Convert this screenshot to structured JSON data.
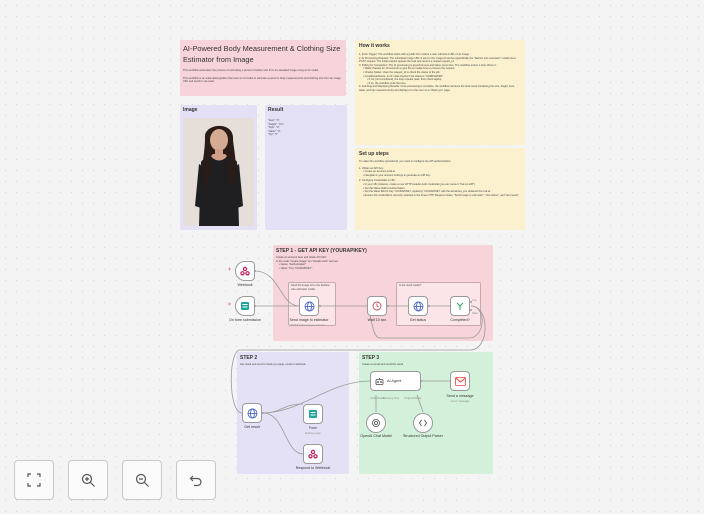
{
  "intro": {
    "title": "AI-Powered Body Measurement & Clothing Size Estimator from Image",
    "para1": "This workflow automates the process of estimating a person's fashion size from an uploaded image using an AI model.",
    "para2": "This workflow is an automated pipeline that uses an AI model to estimate a person's body measurements and clothing size from an image URL and sends it via email."
  },
  "image_panel": {
    "title": "Image"
  },
  "result_panel": {
    "title": "Result",
    "lines": [
      "\"bust\": \"0\",",
      "\"height\": \"0.0\",",
      "\"hips\": \"0\",",
      "\"waist\": \"0\",",
      "\"hip\": \"0\""
    ]
  },
  "how": {
    "title": "How it works",
    "items": [
      "1. Form Trigger: The workflow starts with a public form where a user submits a URL of an image.",
      "2. AI Processing Request: The submitted image URL is sent to the image AI service (specifically the \"fashion size estimator\" model) via a POST request. The initial request queues the task and returns a unique request_id.",
      "3. Polling for Completion: The AI processing is asynchronous and takes some time. The workflow enters a loop where it:",
      "• Waits: Pauses for 10 seconds to give the AI model time to process the request.",
      "• Checks Status: Uses the request_id to check the status of the job.",
      "• Conditional Route: an IF node checks if the status is \"COMPLETED\".",
      "• If not (not completed), the loop repeats (wait, then check again).",
      "• If so, the workflow exits the loop.",
      "4. Fetching and Displaying Results: Once processing is complete, the workflow retrieves the final result containing the size, height, bust, waist, and hip measurements) and displays it to the user on a \"thank you\" page."
    ]
  },
  "setup": {
    "title": "Set up steps",
    "intro": "To make this workflow operational, you need to configure the API authentication:",
    "items": [
      "1. Obtain an API Key:",
      "• Create an account at fal.ai",
      "• Navigate to your account settings to generate an API key.",
      "2. Configure Credentials in n8n:",
      "• In your n8n instance, create a new HTTP Header Auth credential (you can name it \"Fal.run API\").",
      "• Set the Name field to Authorization.",
      "• Set the Value field to Key YOURAPIKEY, replacing YOURAPIKEY with the actual key you obtained from fal.ai.",
      "• Ensure this credential is correctly selected in the three HTTP Request nodes: \"Send image to estimator\", \"Get status\", and \"Get result\"."
    ]
  },
  "step1": {
    "title": "STEP 1 - GET API KEY (YOURAPIKEY)",
    "lines": [
      "Create an account here and obtain API KEY.",
      "In the node \"Create Image\" set \"Header Auth\" and set:",
      "• Name: \"Authorization\"",
      "• Value: \"Key YOURAPIKEY\""
    ],
    "sticky_a": "Send the image url to the Fashion size estimator model",
    "sticky_b": "Is the result ready?"
  },
  "step2": {
    "title": "STEP 2",
    "desc": "Get result and send to thank you page, email or webhook"
  },
  "step3": {
    "title": "STEP 3",
    "desc": "Create an email and send the result"
  },
  "nodes": {
    "webhook": "Webhook",
    "form_submission": "On form submission",
    "send_image": "Send image to estimator",
    "send_image_sub": "POST: https://queue.fal.run/...",
    "wait": "Wait 10 sec",
    "get_status": "Get status",
    "completed": "Completed?",
    "get_result": "Get result",
    "form": "Form",
    "form_sub": "Ending page",
    "respond": "Respond to Webhook",
    "ai_agent": "AI Agent",
    "gmail": "Send a message",
    "gmail_sub": "send: message",
    "openai": "OpenAI Chat Model",
    "parser": "Structured Output Parser",
    "chat_model_tag": "Chat Model",
    "memory_tag": "Memory",
    "tool_tag": "Tool",
    "output_parser_tag": "Output Parser",
    "true_tag": "true",
    "false_tag": "false"
  },
  "controls": {
    "fit": "fit-view",
    "zoom_in": "zoom-in",
    "zoom_out": "zoom-out",
    "undo": "undo"
  },
  "colors": {
    "pink": "#f7d4d9",
    "yellow": "#fbf1cf",
    "purple": "#e4e1f7",
    "green": "#d3f0da",
    "gmail_red": "#ea4335",
    "webhook_pink": "#c2185b",
    "form_teal": "#1fa59b",
    "http_blue": "#4a66c8"
  }
}
